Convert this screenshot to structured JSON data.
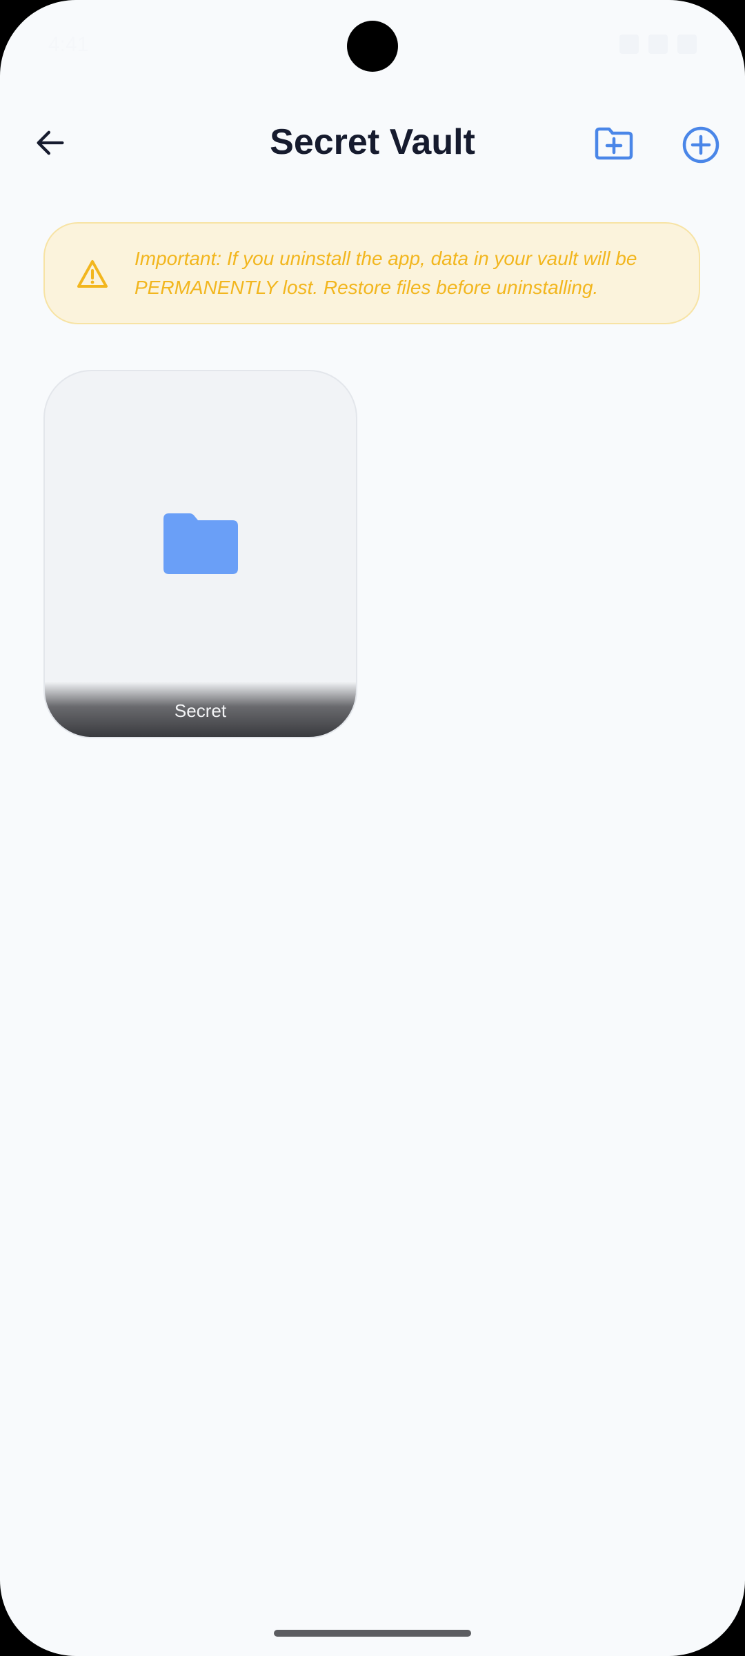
{
  "status_bar": {
    "time": "4:41",
    "icons": [
      "g-icon",
      "shield-icon",
      "wifi-icon",
      "signal-icon",
      "battery-icon"
    ]
  },
  "app_bar": {
    "title": "Secret Vault",
    "back_icon": "arrow-left-icon",
    "new_folder_icon": "folder-plus-icon",
    "add_icon": "plus-circle-icon"
  },
  "warning": {
    "text": "Important: If you uninstall the app, data in your vault will be PERMANENTLY lost. Restore files before uninstalling.",
    "icon": "warning-triangle-icon"
  },
  "folders": [
    {
      "name": "Secret",
      "icon": "folder-icon"
    }
  ],
  "colors": {
    "accent": "#4A86E8",
    "warning_text": "#F2B61E",
    "warning_bg": "#FBF3DC",
    "background": "#F8FAFC",
    "title": "#161B2E"
  }
}
